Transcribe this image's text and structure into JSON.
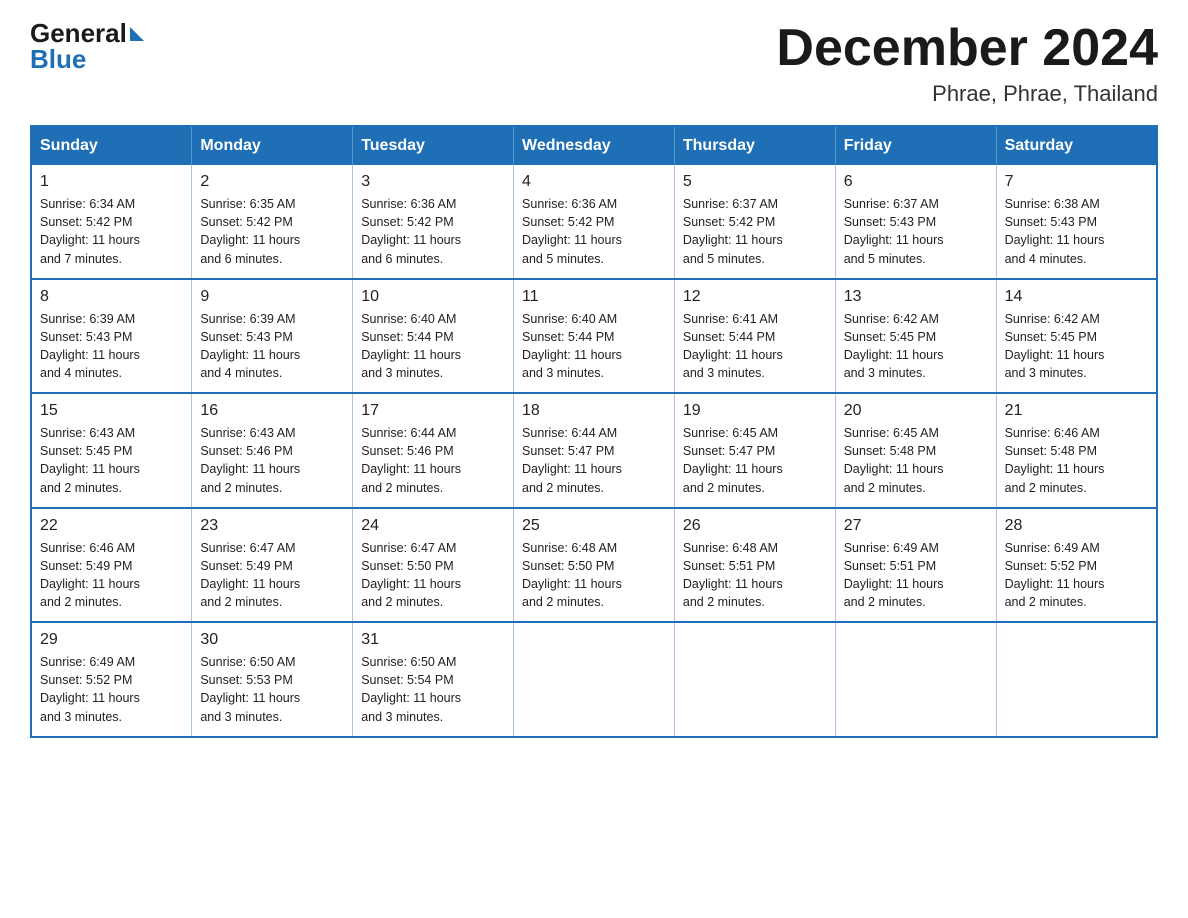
{
  "logo": {
    "general": "General",
    "blue": "Blue"
  },
  "header": {
    "title": "December 2024",
    "subtitle": "Phrae, Phrae, Thailand"
  },
  "days_of_week": [
    "Sunday",
    "Monday",
    "Tuesday",
    "Wednesday",
    "Thursday",
    "Friday",
    "Saturday"
  ],
  "weeks": [
    [
      {
        "day": "1",
        "sunrise": "6:34 AM",
        "sunset": "5:42 PM",
        "daylight": "11 hours and 7 minutes."
      },
      {
        "day": "2",
        "sunrise": "6:35 AM",
        "sunset": "5:42 PM",
        "daylight": "11 hours and 6 minutes."
      },
      {
        "day": "3",
        "sunrise": "6:36 AM",
        "sunset": "5:42 PM",
        "daylight": "11 hours and 6 minutes."
      },
      {
        "day": "4",
        "sunrise": "6:36 AM",
        "sunset": "5:42 PM",
        "daylight": "11 hours and 5 minutes."
      },
      {
        "day": "5",
        "sunrise": "6:37 AM",
        "sunset": "5:42 PM",
        "daylight": "11 hours and 5 minutes."
      },
      {
        "day": "6",
        "sunrise": "6:37 AM",
        "sunset": "5:43 PM",
        "daylight": "11 hours and 5 minutes."
      },
      {
        "day": "7",
        "sunrise": "6:38 AM",
        "sunset": "5:43 PM",
        "daylight": "11 hours and 4 minutes."
      }
    ],
    [
      {
        "day": "8",
        "sunrise": "6:39 AM",
        "sunset": "5:43 PM",
        "daylight": "11 hours and 4 minutes."
      },
      {
        "day": "9",
        "sunrise": "6:39 AM",
        "sunset": "5:43 PM",
        "daylight": "11 hours and 4 minutes."
      },
      {
        "day": "10",
        "sunrise": "6:40 AM",
        "sunset": "5:44 PM",
        "daylight": "11 hours and 3 minutes."
      },
      {
        "day": "11",
        "sunrise": "6:40 AM",
        "sunset": "5:44 PM",
        "daylight": "11 hours and 3 minutes."
      },
      {
        "day": "12",
        "sunrise": "6:41 AM",
        "sunset": "5:44 PM",
        "daylight": "11 hours and 3 minutes."
      },
      {
        "day": "13",
        "sunrise": "6:42 AM",
        "sunset": "5:45 PM",
        "daylight": "11 hours and 3 minutes."
      },
      {
        "day": "14",
        "sunrise": "6:42 AM",
        "sunset": "5:45 PM",
        "daylight": "11 hours and 3 minutes."
      }
    ],
    [
      {
        "day": "15",
        "sunrise": "6:43 AM",
        "sunset": "5:45 PM",
        "daylight": "11 hours and 2 minutes."
      },
      {
        "day": "16",
        "sunrise": "6:43 AM",
        "sunset": "5:46 PM",
        "daylight": "11 hours and 2 minutes."
      },
      {
        "day": "17",
        "sunrise": "6:44 AM",
        "sunset": "5:46 PM",
        "daylight": "11 hours and 2 minutes."
      },
      {
        "day": "18",
        "sunrise": "6:44 AM",
        "sunset": "5:47 PM",
        "daylight": "11 hours and 2 minutes."
      },
      {
        "day": "19",
        "sunrise": "6:45 AM",
        "sunset": "5:47 PM",
        "daylight": "11 hours and 2 minutes."
      },
      {
        "day": "20",
        "sunrise": "6:45 AM",
        "sunset": "5:48 PM",
        "daylight": "11 hours and 2 minutes."
      },
      {
        "day": "21",
        "sunrise": "6:46 AM",
        "sunset": "5:48 PM",
        "daylight": "11 hours and 2 minutes."
      }
    ],
    [
      {
        "day": "22",
        "sunrise": "6:46 AM",
        "sunset": "5:49 PM",
        "daylight": "11 hours and 2 minutes."
      },
      {
        "day": "23",
        "sunrise": "6:47 AM",
        "sunset": "5:49 PM",
        "daylight": "11 hours and 2 minutes."
      },
      {
        "day": "24",
        "sunrise": "6:47 AM",
        "sunset": "5:50 PM",
        "daylight": "11 hours and 2 minutes."
      },
      {
        "day": "25",
        "sunrise": "6:48 AM",
        "sunset": "5:50 PM",
        "daylight": "11 hours and 2 minutes."
      },
      {
        "day": "26",
        "sunrise": "6:48 AM",
        "sunset": "5:51 PM",
        "daylight": "11 hours and 2 minutes."
      },
      {
        "day": "27",
        "sunrise": "6:49 AM",
        "sunset": "5:51 PM",
        "daylight": "11 hours and 2 minutes."
      },
      {
        "day": "28",
        "sunrise": "6:49 AM",
        "sunset": "5:52 PM",
        "daylight": "11 hours and 2 minutes."
      }
    ],
    [
      {
        "day": "29",
        "sunrise": "6:49 AM",
        "sunset": "5:52 PM",
        "daylight": "11 hours and 3 minutes."
      },
      {
        "day": "30",
        "sunrise": "6:50 AM",
        "sunset": "5:53 PM",
        "daylight": "11 hours and 3 minutes."
      },
      {
        "day": "31",
        "sunrise": "6:50 AM",
        "sunset": "5:54 PM",
        "daylight": "11 hours and 3 minutes."
      },
      null,
      null,
      null,
      null
    ]
  ],
  "labels": {
    "sunrise": "Sunrise:",
    "sunset": "Sunset:",
    "daylight": "Daylight:"
  }
}
